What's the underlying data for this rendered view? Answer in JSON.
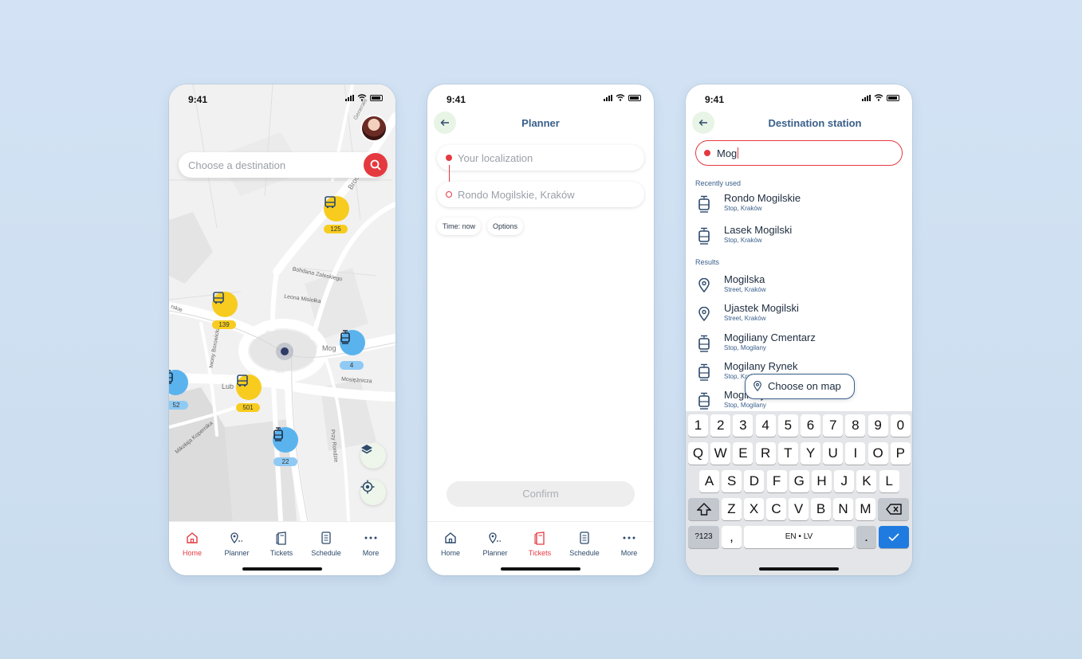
{
  "status": {
    "time": "9:41"
  },
  "home": {
    "search_placeholder": "Choose a destination",
    "map_labels": {
      "generala": "Generała",
      "broc": "Broc",
      "bohdana": "Bohdana Zaleskiego",
      "leona": "Leona Misiołka",
      "iwony": "Iwony Borowickiej",
      "lub": "Lub",
      "mog": "Mog",
      "mosiez": "Mosiężnicza",
      "kopernika": "Mikołaja Kopernika",
      "przy_rondzie": "Przy Rondzie",
      "rskie": "rskie"
    },
    "vehicles": [
      {
        "type": "bus",
        "line": "125"
      },
      {
        "type": "bus",
        "line": "139"
      },
      {
        "type": "tram",
        "line": "4"
      },
      {
        "type": "tram",
        "line": "52"
      },
      {
        "type": "bus",
        "line": "501"
      },
      {
        "type": "tram",
        "line": "22"
      }
    ]
  },
  "nav": {
    "items": [
      {
        "label": "Home",
        "icon": "home-icon"
      },
      {
        "label": "Planner",
        "icon": "planner-icon"
      },
      {
        "label": "Tickets",
        "icon": "ticket-icon"
      },
      {
        "label": "Schedule",
        "icon": "schedule-icon"
      },
      {
        "label": "More",
        "icon": "more-icon"
      }
    ]
  },
  "planner": {
    "title": "Planner",
    "from_placeholder": "Your localization",
    "to_value": "Rondo Mogilskie, Kraków",
    "chips": [
      "Time: now",
      "Options"
    ],
    "confirm": "Confirm"
  },
  "destination": {
    "title": "Destination station",
    "query": "Mog",
    "recently_label": "Recently used",
    "recent": [
      {
        "name": "Rondo Mogilskie",
        "sub": "Stop, Kraków",
        "icon": "tram-icon"
      },
      {
        "name": "Lasek Mogilski",
        "sub": "Stop, Kraków",
        "icon": "tram-icon"
      }
    ],
    "results_label": "Results",
    "results": [
      {
        "name": "Mogilska",
        "sub": "Street, Kraków",
        "icon": "pin-icon"
      },
      {
        "name": "Ujastek Mogilski",
        "sub": "Street, Kraków",
        "icon": "pin-icon"
      },
      {
        "name": "Mogiliany Cmentarz",
        "sub": "Stop, Mogilany",
        "icon": "tram-icon"
      },
      {
        "name": "Mogilany Rynek",
        "sub": "Stop, Kraków",
        "icon": "tram-icon"
      },
      {
        "name": "Mogilany",
        "sub": "Stop, Mogilany",
        "icon": "tram-icon"
      }
    ],
    "choose_on_map": "Choose on map"
  },
  "keyboard": {
    "row1": [
      "1",
      "2",
      "3",
      "4",
      "5",
      "6",
      "7",
      "8",
      "9",
      "0"
    ],
    "row2": [
      "Q",
      "W",
      "E",
      "R",
      "T",
      "Y",
      "U",
      "I",
      "O",
      "P"
    ],
    "row3": [
      "A",
      "S",
      "D",
      "F",
      "G",
      "H",
      "J",
      "K",
      "L"
    ],
    "row4": [
      "Z",
      "X",
      "C",
      "V",
      "B",
      "N",
      "M"
    ],
    "num_key": "?123",
    "comma": ",",
    "space": "EN • LV",
    "period": "."
  },
  "colors": {
    "accent": "#e53940",
    "primary": "#3a5f8a",
    "bus": "#f7cc1f",
    "tram": "#5bb3ee"
  }
}
